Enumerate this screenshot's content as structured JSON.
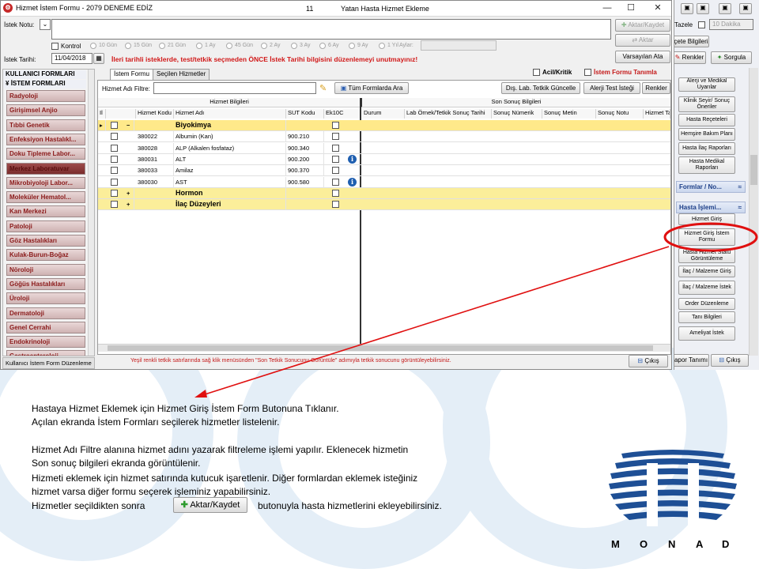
{
  "window": {
    "title": "Hizmet İstem Formu - 2079 DENEME EDİZ",
    "patient_number": "11",
    "caption": "Yatan Hasta Hizmet Ekleme",
    "minimize": "—",
    "maximize": "☐",
    "close": "✕"
  },
  "top_form": {
    "istek_notu_label": "İstek Notu:",
    "kontrol_label": "Kontrol",
    "period_options": [
      "10 Gün",
      "15 Gün",
      "21 Gün",
      "1 Ay",
      "45 Gün",
      "2 Ay",
      "3 Ay",
      "6 Ay",
      "9 Ay",
      "1 Yıl"
    ],
    "aylar_label": "Aylar:",
    "istek_tarihi_label": "İstek Tarihi:",
    "istek_tarihi_value": "11/04/2018",
    "warning": "İleri tarihli isteklerde, test/tetkik seçmeden ÖNCE İstek Tarihi bilgisini düzenlemeyi unutmayınız!",
    "aktar_kaydet": "Aktar/Kaydet",
    "aktar": "Aktar",
    "varsayilan_ata": "Varsayılan Ata",
    "acil_kritik": "Acil/Kritik",
    "istem_formu_tanimla": "İstem Formu Tanımla"
  },
  "left_panel": {
    "head1": "KULLANICI FORMLARI",
    "head2": "İSTEM FORMLARI",
    "items": [
      "Radyoloji",
      "Girişimsel Anjio",
      "Tıbbi Genetik",
      "Enfeksiyon Hastalıkl...",
      "Doku Tipleme Labor...",
      "Merkez Laboratuvar",
      "Mikrobiyoloji Labor...",
      "Moleküler Hematol...",
      "Kan Merkezi",
      "Patoloji",
      "Göz Hastalıkları",
      "Kulak-Burun-Boğaz",
      "Nöroloji",
      "Göğüs Hastalıkları",
      "Üroloji",
      "Dermatoloji",
      "Genel Cerrahi",
      "Endokrinoloji",
      "Gastroenteroloji"
    ],
    "bottom": "Kullanıcı İstem Form Düzenleme"
  },
  "tabs": [
    "İstem Formu",
    "Seçilen Hizmetler"
  ],
  "filter": {
    "label": "Hizmet Adı Filtre:",
    "all_forms_button": "Tüm Formlarda Ara",
    "dis_lab_button": "Dış. Lab. Tetkik Güncelle",
    "allergy_button": "Alerji Test İsteği",
    "colors_button": "Renkler"
  },
  "grid": {
    "group1_header": "Hizmet Bilgileri",
    "group2_header": "Son Sonuç Bilgileri",
    "columns": [
      "Il",
      "Hizmet Kodu",
      "Hizmet Adı",
      "SUT Kodu",
      "Ek10C",
      "Durum",
      "Lab Örnek/Tetkik Sonuç Tarihi",
      "Sonuç Nümerik",
      "Sonuç Metin",
      "Sonuç Notu",
      "Hizmet Ta"
    ],
    "rows": [
      {
        "type": "group",
        "expander": "−",
        "name": "Biyokimya",
        "selected": true
      },
      {
        "type": "item",
        "code": "380022",
        "name": "Albumin (Kan)",
        "sut": "900.210",
        "info": false
      },
      {
        "type": "item",
        "code": "380028",
        "name": "ALP (Alkalen fosfataz)",
        "sut": "900.340",
        "info": false
      },
      {
        "type": "item",
        "code": "380031",
        "name": "ALT",
        "sut": "900.200",
        "info": true
      },
      {
        "type": "item",
        "code": "380033",
        "name": "Amilaz",
        "sut": "900.370",
        "info": false
      },
      {
        "type": "item",
        "code": "380030",
        "name": "AST",
        "sut": "900.580",
        "info": true
      },
      {
        "type": "group",
        "expander": "+",
        "name": "Hormon",
        "selected": false
      },
      {
        "type": "group",
        "expander": "+",
        "name": "İlaç Düzeyleri",
        "selected": false
      }
    ],
    "info_glyph": "i"
  },
  "status": {
    "hint": "Yeşil renkli tetkik satırlarında sağ klik menüsünden \"Son Tetkik Sonucunu Görüntüle\" adımıyla tetkik sonucunu görüntüleyebilirsiniz.",
    "exit": "Çıkış",
    "right_exit": "Çıkış",
    "right_rapor": "apor Tanımı"
  },
  "right_panel": {
    "tazele": "Tazele",
    "dakika": "10 Dakika",
    "recete_bilgileri": "çete Bilgileri",
    "renkler": "Renkler",
    "sorgula": "Sorgula",
    "buttons_top": [
      "Alerji ve Medikal Uyarılar",
      "Klinik Seyir/ Sonuç Öneriler",
      "Hasta Reçeteleri",
      "Hemşire Bakım Planı",
      "Hasta İlaç Raporları",
      "Hasta Medikal Raporları"
    ],
    "section1": "Formlar / No...",
    "section2": "Hasta İşlemi...",
    "chevron": "≈",
    "buttons_bottom": [
      "Hizmet Giriş",
      "Hizmet Giriş İstem Formu",
      "Hasta Hizmet Statü Görüntüleme",
      "İlaç / Malzeme Giriş",
      "İlaç / Malzeme İstek",
      "Order Düzenleme",
      "Tanı Bilgileri",
      "Ameliyat İstek"
    ]
  },
  "annotation": {
    "line1": "Hastaya Hizmet Eklemek için Hizmet Giriş İstem Form Butonuna Tıklanır.",
    "line2": "Açılan ekranda İstem Formları seçilerek hizmetler listelenir.",
    "line3": "Hizmet Adı Filtre alanına hizmet adını yazarak filtreleme işlemi yapılır.  Eklenecek hizmetin",
    "line4": " Son sonuç bilgileri ekranda görüntülenir.",
    "line5": " Hizmeti eklemek için hizmet satırında kutucuk işaretlenir.  Diğer formlardan eklemek isteğiniz",
    "line6": " hizmet varsa diğer formu seçerek işleminiz yapabilirsiniz.",
    "line7a": " Hizmetler seçildikten sonra",
    "line7_button": "Aktar/Kaydet",
    "line7b": "butonuyla hasta hizmetlerini ekleyebilirsiniz."
  },
  "logo": {
    "letters": [
      "M",
      "O",
      "N",
      "A",
      "D"
    ]
  },
  "colors": {
    "accent_red": "#d11818",
    "group_yellow": "#fbee9a",
    "selected_blue": "#1f5fb0",
    "header_blue": "#1d3f88"
  }
}
